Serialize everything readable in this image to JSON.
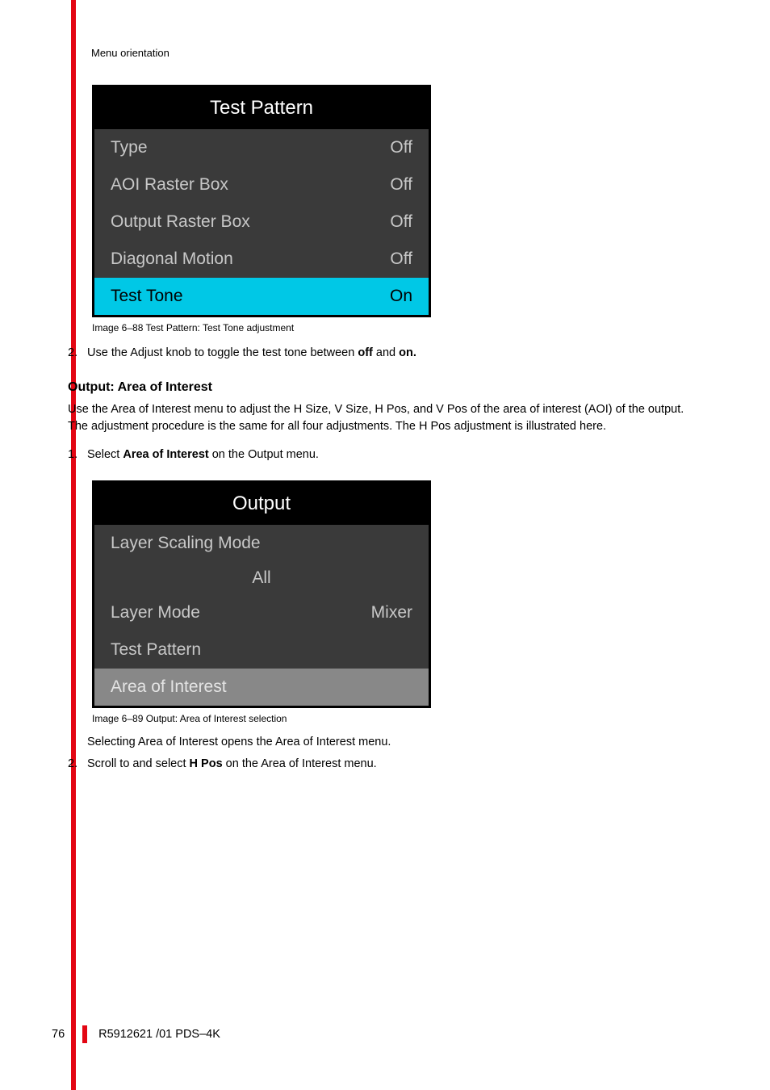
{
  "header": {
    "section": "Menu orientation"
  },
  "figure1": {
    "title": "Test Pattern",
    "rows": [
      {
        "label": "Type",
        "value": "Off"
      },
      {
        "label": "AOI Raster Box",
        "value": "Off"
      },
      {
        "label": "Output Raster Box",
        "value": "Off"
      },
      {
        "label": "Diagonal Motion",
        "value": "Off"
      },
      {
        "label": "Test Tone",
        "value": "On"
      }
    ],
    "caption": "Image 6–88  Test Pattern: Test Tone adjustment"
  },
  "step2_prefix": "2.",
  "step2_text_a": "Use the Adjust knob to toggle the test tone between ",
  "step2_off": "off",
  "step2_and": " and ",
  "step2_on": "on.",
  "section2": {
    "heading": "Output: Area of Interest",
    "body": "Use the Area of Interest menu to adjust the H Size, V Size, H Pos, and V Pos of the area of interest (AOI) of the output. The adjustment procedure is the same for all four adjustments. The H Pos adjustment is illustrated here."
  },
  "step1b_prefix": "1.",
  "step1b_text_a": "Select ",
  "step1b_bold": "Area of Interest",
  "step1b_text_b": " on the Output menu.",
  "figure2": {
    "title": "Output",
    "row1_label": "Layer Scaling Mode",
    "row2_centered": "All",
    "row3_label": "Layer Mode",
    "row3_value": "Mixer",
    "row4_label": "Test Pattern",
    "row5_label": "Area of Interest",
    "caption": "Image 6–89  Output: Area of Interest selection"
  },
  "aftertext": "Selecting Area of Interest opens the Area of Interest menu.",
  "step2b_prefix": "2.",
  "step2b_text_a": "Scroll to and select ",
  "step2b_bold": "H Pos",
  "step2b_text_b": " on the Area of Interest menu.",
  "footer": {
    "page": "76",
    "docid": "R5912621 /01 PDS–4K"
  }
}
